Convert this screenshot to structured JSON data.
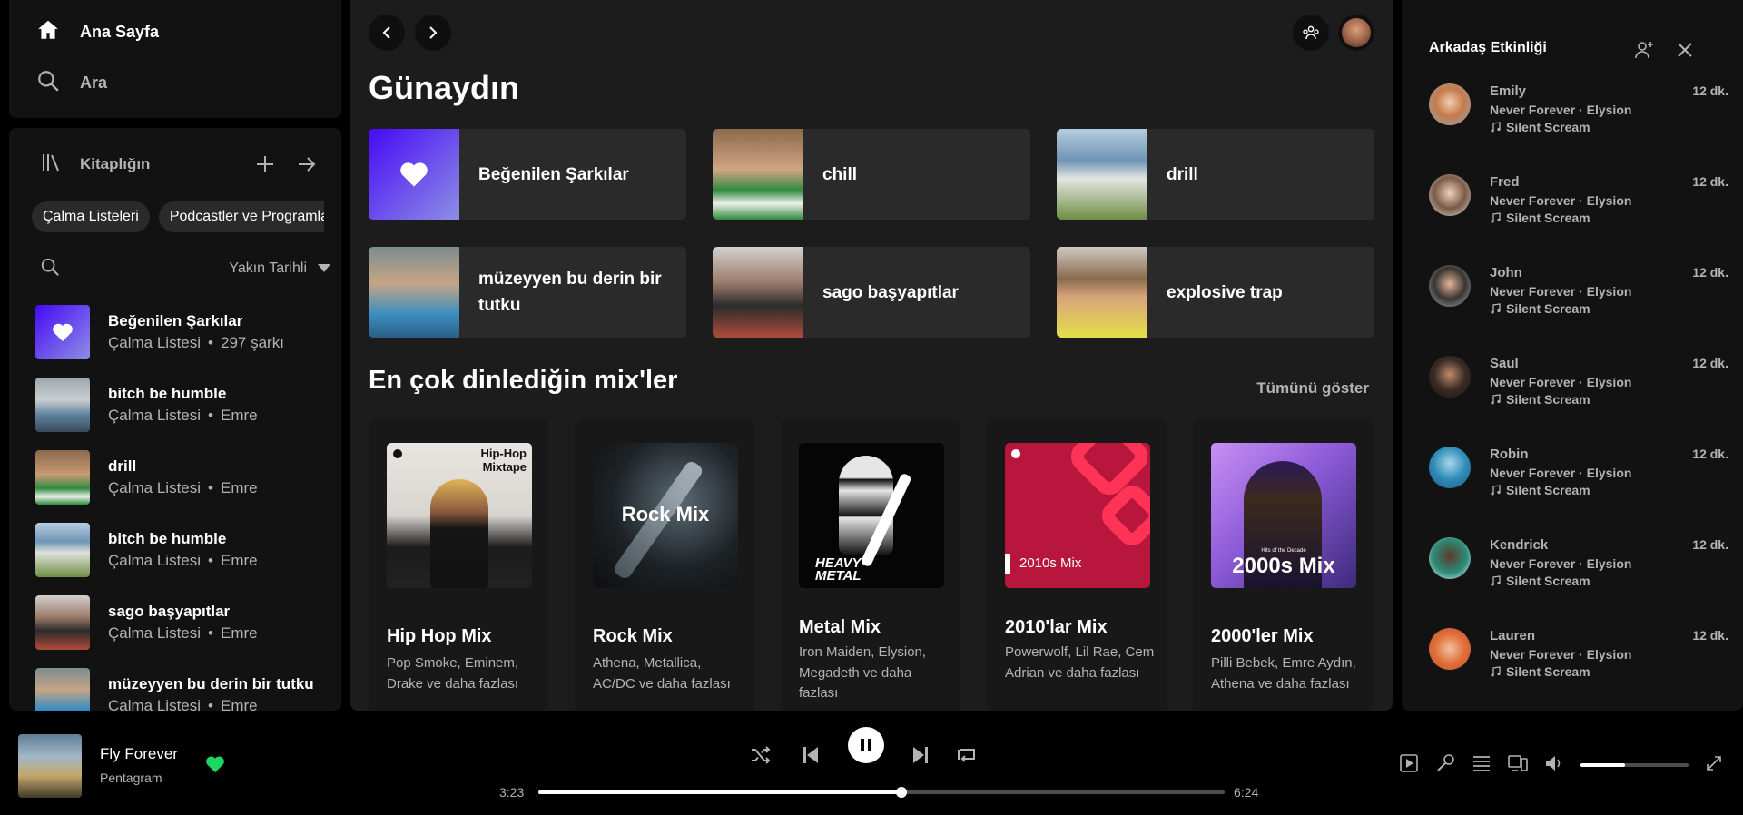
{
  "nav": {
    "home": "Ana Sayfa",
    "search": "Ara"
  },
  "library": {
    "title": "Kitaplığın",
    "chips": [
      "Çalma Listeleri",
      "Podcastler ve Programlar"
    ],
    "sort_label": "Yakın Tarihli",
    "items": [
      {
        "name": "Beğenilen Şarkılar",
        "type": "Çalma Listesi",
        "meta": "297 şarkı",
        "thumb": "liked"
      },
      {
        "name": "bitch be humble",
        "type": "Çalma Listesi",
        "meta": "Emre",
        "thumb": "a"
      },
      {
        "name": "drill",
        "type": "Çalma Listesi",
        "meta": "Emre",
        "thumb": "b"
      },
      {
        "name": "bitch be humble",
        "type": "Çalma Listesi",
        "meta": "Emre",
        "thumb": "c"
      },
      {
        "name": "sago başyapıtlar",
        "type": "Çalma Listesi",
        "meta": "Emre",
        "thumb": "d"
      },
      {
        "name": "müzeyyen bu derin bir tutku",
        "type": "Çalma Listesi",
        "meta": "Emre",
        "thumb": "e"
      }
    ]
  },
  "main": {
    "greeting": "Günaydın",
    "quick": [
      {
        "label": "Beğenilen Şarkılar"
      },
      {
        "label": "chill"
      },
      {
        "label": "drill"
      },
      {
        "label": "müzeyyen bu derin bir tutku"
      },
      {
        "label": "sago başyapıtlar"
      },
      {
        "label": "explosive trap"
      }
    ],
    "section_title": "En çok dinlediğin mix'ler",
    "show_all": "Tümünü göster",
    "mixes": [
      {
        "title": "Hip Hop Mix",
        "subtitle": "Pop Smoke, Eminem, Drake ve daha fazlası",
        "cover_text": "Hip-Hop Mixtape"
      },
      {
        "title": "Rock Mix",
        "subtitle": "Athena, Metallica, AC/DC ve daha fazlası",
        "cover_text": "Rock Mix"
      },
      {
        "title": "Metal Mix",
        "subtitle": "Iron Maiden, Elysion, Megadeth ve daha fazlası",
        "cover_text": "HEAVY METAL"
      },
      {
        "title": "2010'lar Mix",
        "subtitle": "Powerwolf, Lil Rae, Cem Adrian ve daha fazlası",
        "cover_text": "2010s Mix"
      },
      {
        "title": "2000'ler Mix",
        "subtitle": "Pilli Bebek, Emre Aydın, Athena ve daha fazlası",
        "cover_text": "2000s Mix",
        "cover_small": "Hits of the Decade"
      }
    ]
  },
  "friends": {
    "title": "Arkadaş Etkinliği",
    "items": [
      {
        "name": "Emily",
        "time": "12 dk.",
        "track": "Never Forever",
        "artist": "Elysion",
        "source": "Silent Scream"
      },
      {
        "name": "Fred",
        "time": "12 dk.",
        "track": "Never Forever",
        "artist": "Elysion",
        "source": "Silent Scream"
      },
      {
        "name": "John",
        "time": "12 dk.",
        "track": "Never Forever",
        "artist": "Elysion",
        "source": "Silent Scream"
      },
      {
        "name": "Saul",
        "time": "12 dk.",
        "track": "Never Forever",
        "artist": "Elysion",
        "source": "Silent Scream"
      },
      {
        "name": "Robin",
        "time": "12 dk.",
        "track": "Never Forever",
        "artist": "Elysion",
        "source": "Silent Scream"
      },
      {
        "name": "Kendrick",
        "time": "12 dk.",
        "track": "Never Forever",
        "artist": "Elysion",
        "source": "Silent Scream"
      },
      {
        "name": "Lauren",
        "time": "12 dk.",
        "track": "Never Forever",
        "artist": "Elysion",
        "source": "Silent Scream"
      }
    ]
  },
  "player": {
    "title": "Fly Forever",
    "artist": "Pentagram",
    "elapsed": "3:23",
    "duration": "6:24",
    "progress": 0.529,
    "volume": 0.42
  },
  "colors": {
    "accent": "#1ed760",
    "liked_gradient_from": "#450af5",
    "liked_gradient_to": "#8e8ee5"
  }
}
